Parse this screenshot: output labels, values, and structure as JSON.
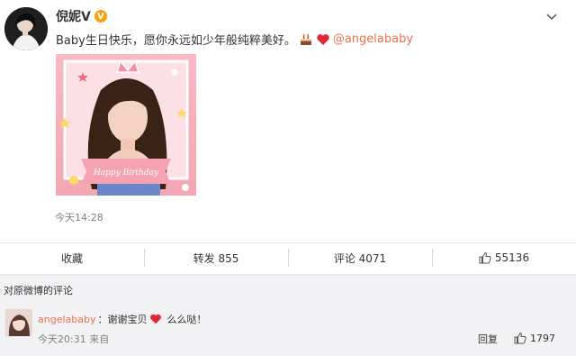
{
  "post": {
    "author": "倪妮V",
    "verified_badge": "V",
    "text": "Baby生日快乐，愿你永远如少年般纯粹美好。",
    "mention": "@angelababy",
    "photo_caption": "Happy Birthday",
    "timestamp": "今天14:28"
  },
  "actions": {
    "favorite": "收藏",
    "repost": "转发 855",
    "comment": "评论 4071",
    "like": "55136"
  },
  "comments_header": "对原微博的评论",
  "comment": {
    "user": "angelababy",
    "text": "：谢谢宝贝",
    "text_after": "么么哒！",
    "meta": "今天20:31 来自",
    "reply_label": "回复",
    "likes": "1797"
  },
  "colors": {
    "mention": "#eb7350",
    "verified": "#f7a10d",
    "heart": "#e0283a",
    "comments_bg": "#f2f2f5"
  }
}
